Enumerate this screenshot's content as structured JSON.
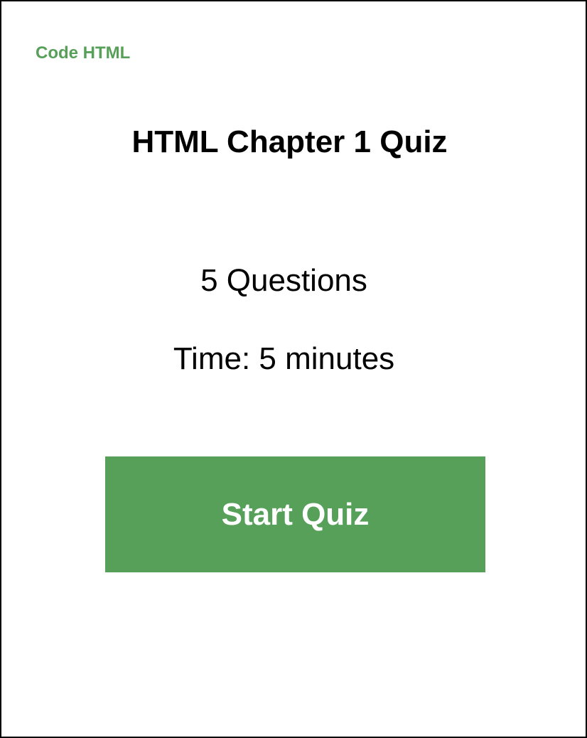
{
  "header": {
    "brand": "Code HTML"
  },
  "quiz": {
    "title": "HTML Chapter 1 Quiz",
    "questions_text": "5 Questions",
    "time_text": "Time: 5 minutes",
    "start_label": "Start Quiz"
  },
  "colors": {
    "accent": "#57a05a",
    "text": "#000000",
    "background": "#ffffff",
    "border": "#000000"
  }
}
